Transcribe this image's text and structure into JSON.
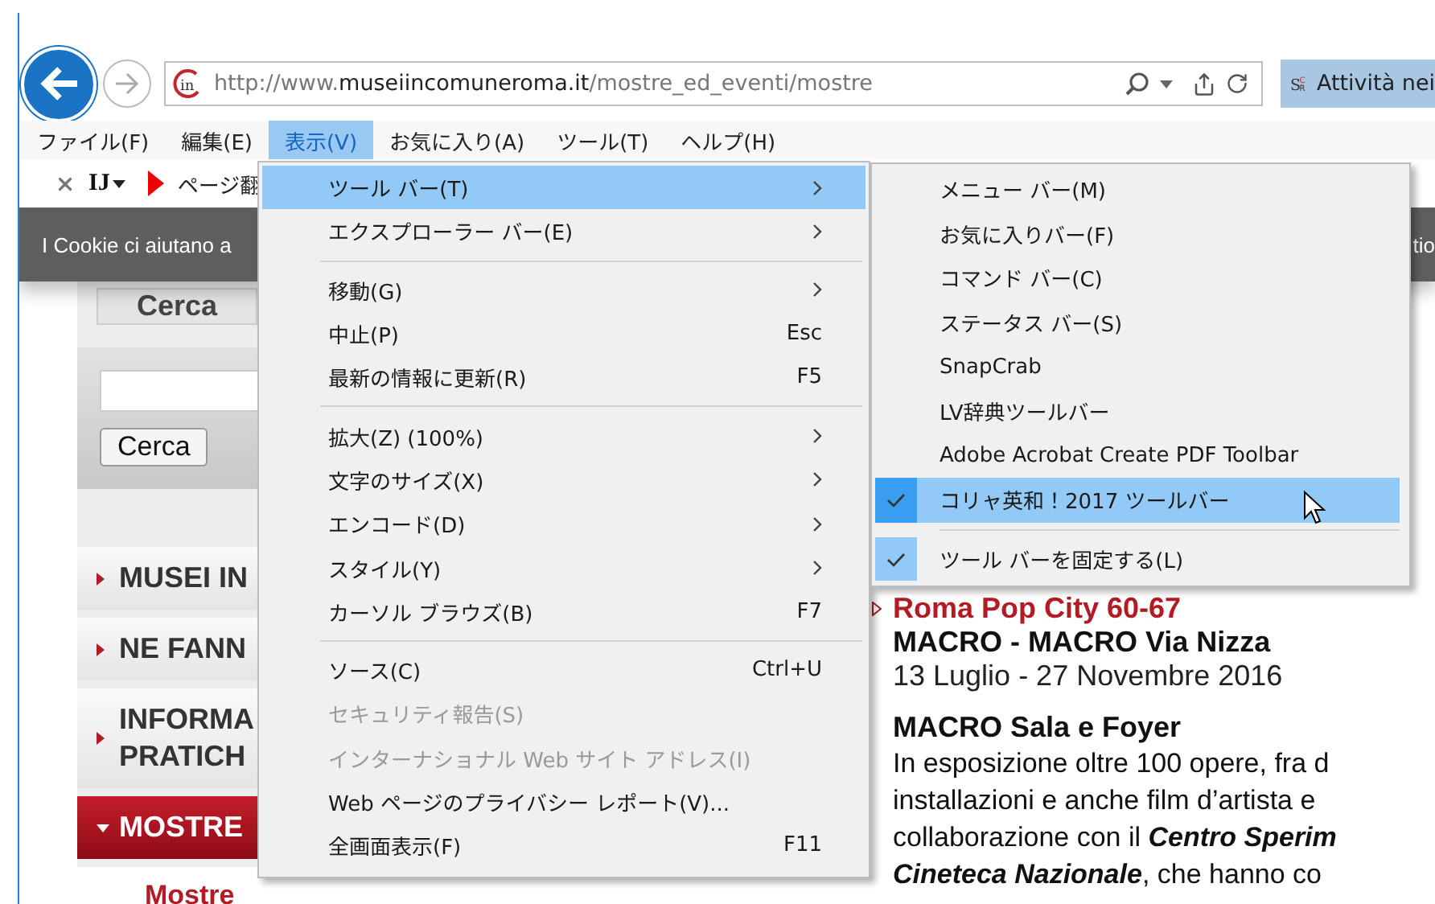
{
  "address_bar": {
    "site_logo": "in",
    "url": "http://www.**museiincomuneroma.it**/mostre_ed_eventi/mostre"
  },
  "browser_tab": {
    "logo": [
      "S",
      "C",
      "R"
    ],
    "title": "Attività nei"
  },
  "menu_bar": [
    {
      "label": "ファイル(F)",
      "selected": false
    },
    {
      "label": "編集(E)",
      "selected": false
    },
    {
      "label": "表示(V)",
      "selected": true
    },
    {
      "label": "お気に入り(A)",
      "selected": false
    },
    {
      "label": "ツール(T)",
      "selected": false
    },
    {
      "label": "ヘルプ(H)",
      "selected": false
    }
  ],
  "extension_bar": {
    "logo": "IJ",
    "translate_label": "ページ翻"
  },
  "cookie_banner": {
    "text": "I Cookie ci aiutano a",
    "text_right": "tio"
  },
  "sidebar": {
    "search_tab": "Cerca",
    "search_button": "Cerca",
    "nav": [
      {
        "label": "MUSEI IN",
        "selected": false
      },
      {
        "label": "NE FANN",
        "selected": false
      },
      {
        "label": "INFORMA\nPRATICH",
        "selected": false
      },
      {
        "label": "MOSTRE",
        "selected": true
      }
    ],
    "subnav": [
      {
        "label": "Mostre"
      }
    ]
  },
  "article": {
    "title": "Roma Pop City 60-67",
    "venue": "MACRO - MACRO Via Nizza",
    "dates": "13 Luglio - 27 Novembre 2016",
    "section": "MACRO Sala e Foyer",
    "body": "In esposizione oltre 100 opere, fra d\ninstallazioni e anche film d’artista e\ncollaborazione con il **Centro Sperim**\n**Cineteca Nazionale**, che hanno co"
  },
  "view_menu": {
    "items": [
      {
        "kind": "item",
        "label": "ツール バー(T)",
        "submenu": true,
        "selected": true,
        "disabled": false
      },
      {
        "kind": "item",
        "label": "エクスプローラー バー(E)",
        "submenu": true,
        "selected": false,
        "disabled": false
      },
      {
        "kind": "separator"
      },
      {
        "kind": "item",
        "label": "移動(G)",
        "submenu": true,
        "selected": false,
        "disabled": false
      },
      {
        "kind": "item",
        "label": "中止(P)",
        "shortcut": "Esc",
        "submenu": false,
        "selected": false,
        "disabled": false
      },
      {
        "kind": "item",
        "label": "最新の情報に更新(R)",
        "shortcut": "F5",
        "submenu": false,
        "selected": false,
        "disabled": false
      },
      {
        "kind": "separator"
      },
      {
        "kind": "item",
        "label": "拡大(Z) (100%)",
        "submenu": true,
        "selected": false,
        "disabled": false
      },
      {
        "kind": "item",
        "label": "文字のサイズ(X)",
        "submenu": true,
        "selected": false,
        "disabled": false
      },
      {
        "kind": "item",
        "label": "エンコード(D)",
        "submenu": true,
        "selected": false,
        "disabled": false
      },
      {
        "kind": "item",
        "label": "スタイル(Y)",
        "submenu": true,
        "selected": false,
        "disabled": false
      },
      {
        "kind": "item",
        "label": "カーソル ブラウズ(B)",
        "shortcut": "F7",
        "submenu": false,
        "selected": false,
        "disabled": false
      },
      {
        "kind": "separator"
      },
      {
        "kind": "item",
        "label": "ソース(C)",
        "shortcut": "Ctrl+U",
        "submenu": false,
        "selected": false,
        "disabled": false
      },
      {
        "kind": "item",
        "label": "セキュリティ報告(S)",
        "submenu": false,
        "selected": false,
        "disabled": true
      },
      {
        "kind": "item",
        "label": "インターナショナル Web サイト アドレス(I)",
        "submenu": false,
        "selected": false,
        "disabled": true
      },
      {
        "kind": "item",
        "label": "Web ページのプライバシー レポート(V)...",
        "submenu": false,
        "selected": false,
        "disabled": false
      },
      {
        "kind": "item",
        "label": "全画面表示(F)",
        "shortcut": "F11",
        "submenu": false,
        "selected": false,
        "disabled": false
      }
    ]
  },
  "toolbars_submenu": {
    "items": [
      {
        "kind": "item",
        "label": "メニュー バー(M)",
        "checked": false,
        "selected": false
      },
      {
        "kind": "item",
        "label": "お気に入りバー(F)",
        "checked": false,
        "selected": false
      },
      {
        "kind": "item",
        "label": "コマンド バー(C)",
        "checked": false,
        "selected": false
      },
      {
        "kind": "item",
        "label": "ステータス バー(S)",
        "checked": false,
        "selected": false
      },
      {
        "kind": "item",
        "label": "SnapCrab",
        "checked": false,
        "selected": false
      },
      {
        "kind": "item",
        "label": "LV辞典ツールバー",
        "checked": false,
        "selected": false
      },
      {
        "kind": "item",
        "label": "Adobe Acrobat Create PDF Toolbar",
        "checked": false,
        "selected": false
      },
      {
        "kind": "item",
        "label": "コリャ英和！2017 ツールバー",
        "checked": true,
        "selected": true
      },
      {
        "kind": "separator"
      },
      {
        "kind": "item",
        "label": "ツール バーを固定する(L)",
        "checked": true,
        "selected": false
      }
    ]
  }
}
